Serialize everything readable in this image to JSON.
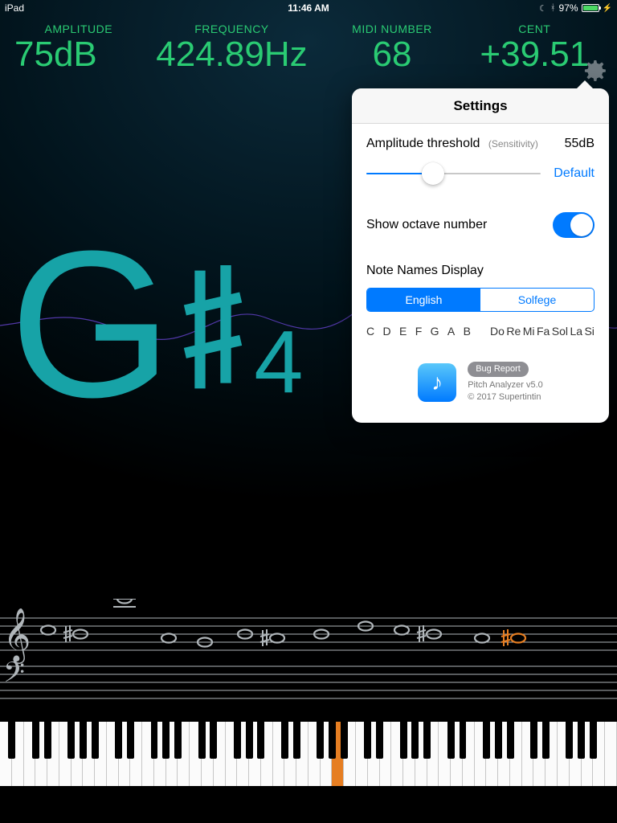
{
  "status": {
    "device": "iPad",
    "time": "11:46 AM",
    "battery_pct": "97%"
  },
  "readouts": {
    "amplitude": {
      "label": "AMPLITUDE",
      "value": "75dB"
    },
    "frequency": {
      "label": "FREQUENCY",
      "value": "424.89Hz"
    },
    "midi": {
      "label": "MIDI NUMBER",
      "value": "68"
    },
    "cent": {
      "label": "CENT",
      "value": "+39.51"
    }
  },
  "note": {
    "letter": "G",
    "accidental": "sharp",
    "octave": "4"
  },
  "settings": {
    "title": "Settings",
    "amplitude_threshold_label": "Amplitude threshold",
    "sensitivity_label": "(Sensitivity)",
    "amplitude_threshold_value": "55dB",
    "slider_fraction": 0.38,
    "default_label": "Default",
    "show_octave_label": "Show octave number",
    "show_octave_on": true,
    "note_names_label": "Note Names Display",
    "segments": {
      "english": "English",
      "solfege": "Solfege",
      "active": "english"
    },
    "english_notes": [
      "C",
      "D",
      "E",
      "F",
      "G",
      "A",
      "B"
    ],
    "solfege_notes": [
      "Do",
      "Re",
      "Mi",
      "Fa",
      "Sol",
      "La",
      "Si"
    ],
    "bug_report": "Bug Report",
    "app_name_version": "Pitch Analyzer v5.0",
    "copyright": "© 2017 Supertintin"
  },
  "piano": {
    "total_white_keys": 52,
    "highlight_white_index": 28,
    "highlight_is_black_after_white_index": null
  },
  "colors": {
    "accent_green": "#2acb73",
    "accent_teal": "#17a3a7",
    "highlight_orange": "#e67e22",
    "ios_blue": "#007aff"
  }
}
